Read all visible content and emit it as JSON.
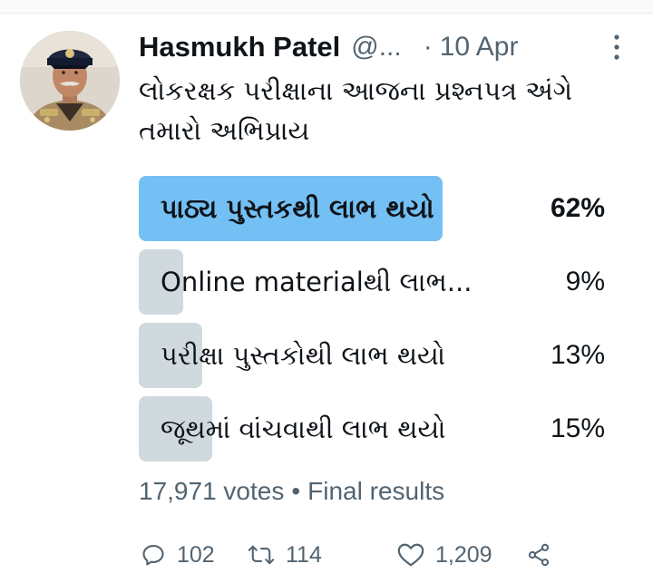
{
  "tweet": {
    "author_name": "Hasmukh Patel",
    "handle": "@...",
    "separator": "·",
    "date": "10 Apr",
    "text": "લોકરક્ષક પરીક્ષાના આજના પ્રશ્નપત્ર અંગે તમારો અભિપ્રાય",
    "avatar_icon": "police-officer-avatar",
    "more_icon": "vertical-dots-icon"
  },
  "poll": {
    "options": [
      {
        "label": "પાઠ્ય પુસ્તકથી લાભ થયો",
        "percent_text": "62%",
        "percent": 62,
        "winner": true
      },
      {
        "label": "Online materialથી લાભ...",
        "percent_text": "9%",
        "percent": 9,
        "winner": false
      },
      {
        "label": "પરીક્ષા પુસ્તકોથી લાભ થયો",
        "percent_text": "13%",
        "percent": 13,
        "winner": false
      },
      {
        "label": "જૂથમાં વાંચવાથી લાભ થયો",
        "percent_text": "15%",
        "percent": 15,
        "winner": false
      }
    ],
    "votes": "17,971 votes",
    "separator": "•",
    "status": "Final results"
  },
  "actions": {
    "reply_count": "102",
    "retweet_count": "114",
    "like_count": "1,209"
  },
  "colors": {
    "winner_bar": "#74c0f4",
    "other_bar": "#cfd9de",
    "secondary_text": "#536471",
    "primary_text": "#0f1419"
  }
}
